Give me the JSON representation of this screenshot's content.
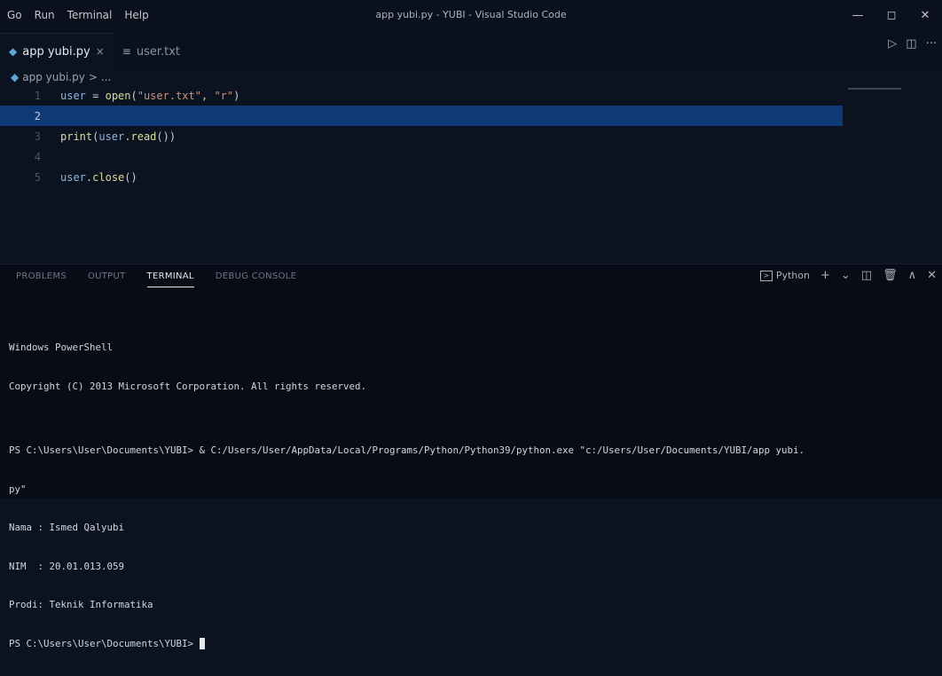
{
  "menu": [
    "Go",
    "Run",
    "Terminal",
    "Help"
  ],
  "window_title": "app yubi.py - YUBI - Visual Studio Code",
  "window_controls": {
    "minimize": "—",
    "maximize": "◻",
    "close": "✕"
  },
  "tabs": [
    {
      "icon": "python-file-icon",
      "label": "app yubi.py",
      "active": true,
      "close": "×"
    },
    {
      "icon": "text-file-icon",
      "label": "user.txt",
      "active": false
    }
  ],
  "tab_actions": {
    "run": "▷",
    "split": "◫",
    "more": "···"
  },
  "breadcrumb": {
    "file": "app yubi.py",
    "sep": ">",
    "trail": "..."
  },
  "code": [
    {
      "n": "1",
      "tokens": [
        [
          "var",
          "user"
        ],
        [
          "p",
          " = "
        ],
        [
          "fn",
          "open"
        ],
        [
          "p",
          "("
        ],
        [
          "str",
          "\"user.txt\""
        ],
        [
          "p",
          ", "
        ],
        [
          "str",
          "\"r\""
        ],
        [
          "p",
          ")"
        ]
      ]
    },
    {
      "n": "2",
      "tokens": [],
      "highlight": true
    },
    {
      "n": "3",
      "tokens": [
        [
          "fn",
          "print"
        ],
        [
          "p",
          "("
        ],
        [
          "var",
          "user"
        ],
        [
          "p",
          "."
        ],
        [
          "fn",
          "read"
        ],
        [
          "p",
          "())"
        ]
      ]
    },
    {
      "n": "4",
      "tokens": []
    },
    {
      "n": "5",
      "tokens": [
        [
          "var",
          "user"
        ],
        [
          "p",
          "."
        ],
        [
          "fn",
          "close"
        ],
        [
          "p",
          "()"
        ]
      ]
    }
  ],
  "panel": {
    "tabs": [
      {
        "label": "PROBLEMS",
        "active": false
      },
      {
        "label": "OUTPUT",
        "active": false
      },
      {
        "label": "TERMINAL",
        "active": true
      },
      {
        "label": "DEBUG CONSOLE",
        "active": false
      }
    ],
    "shell_label": "Python",
    "actions": {
      "add": "+",
      "dropdown": "⌄",
      "split": "◫",
      "trash": "🗑",
      "maximize": "∧",
      "close": "✕"
    }
  },
  "terminal_lines": [
    "Windows PowerShell",
    "Copyright (C) 2013 Microsoft Corporation. All rights reserved.",
    "",
    "PS C:\\Users\\User\\Documents\\YUBI> & C:/Users/User/AppData/Local/Programs/Python/Python39/python.exe \"c:/Users/User/Documents/YUBI/app yubi.",
    "py\"",
    "Nama : Ismed Qalyubi",
    "NIM  : 20.01.013.059",
    "Prodi: Teknik Informatika",
    "PS C:\\Users\\User\\Documents\\YUBI> "
  ]
}
